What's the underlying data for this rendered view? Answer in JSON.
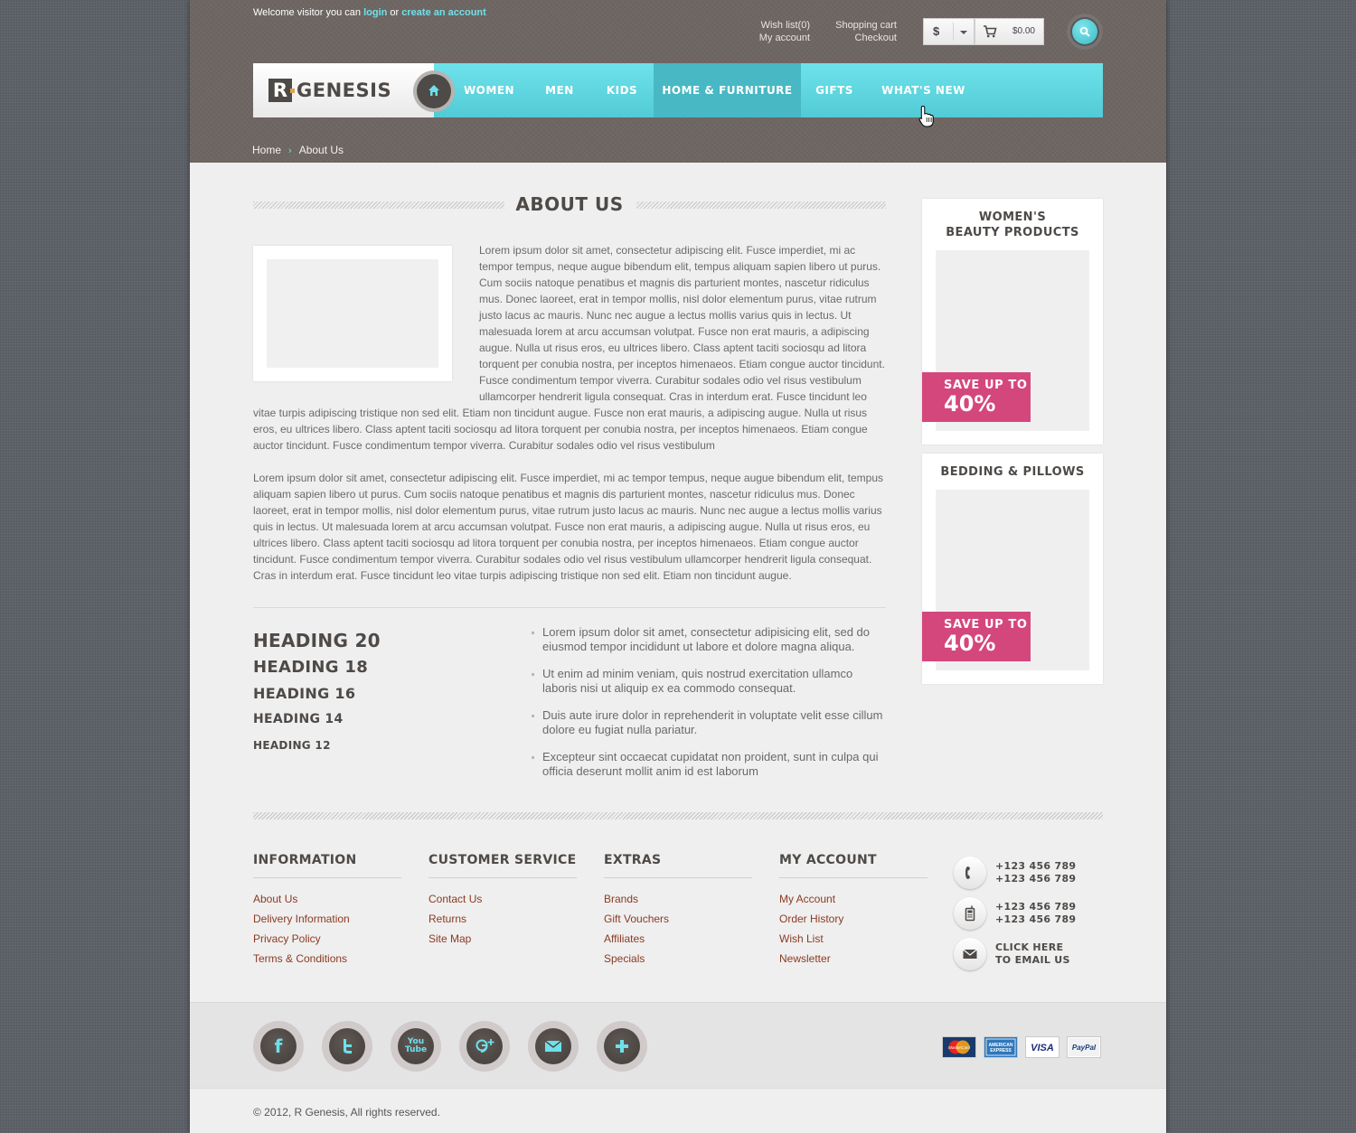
{
  "header": {
    "welcome_prefix": "Welcome visitor you can",
    "login_label": "login",
    "or_label": "or",
    "create_account_label": "create an account",
    "wishlist_label": "Wish list(0)",
    "my_account_label": "My account",
    "shopping_cart_label": "Shopping cart",
    "checkout_label": "Checkout",
    "currency": "$",
    "cart_total": "$0.00"
  },
  "logo": {
    "mark": "R",
    "text": "GENESIS"
  },
  "nav": {
    "items": [
      {
        "label": "WOMEN"
      },
      {
        "label": "MEN"
      },
      {
        "label": "KIDS"
      },
      {
        "label": "HOME & FURNITURE",
        "active": true
      },
      {
        "label": "GIFTS"
      },
      {
        "label": "WHAT'S NEW"
      }
    ]
  },
  "breadcrumb": {
    "home": "Home",
    "current": "About Us"
  },
  "main": {
    "title": "ABOUT US",
    "p1_part1": "Lorem ipsum dolor sit amet, consectetur adipiscing elit. Fusce imperdiet, mi ac tempor tempus, neque augue bibendum elit, tempus aliquam sapien libero ut purus. Cum sociis natoque penatibus et magnis dis parturient montes, nascetur ridiculus mus. Donec laoreet, erat in tempor mollis, nisl dolor elementum purus, vitae rutrum justo lacus ac mauris. Nunc nec augue a lectus mollis varius quis in lectus. Ut malesuada lorem at arcu accumsan volutpat. Fusce non erat mauris, a adipiscing augue. Nulla ut risus eros, eu ultrices libero. Class aptent taciti sociosqu ad litora torquent per conubia nostra, per inceptos himenaeos. Etiam congue auctor tincidunt. Fusce condimentum tempor viverra. Curabitur sodales odio vel risus vestibulum ullamcorper hendrerit ligula consequat. Cras in interdum erat. Fusce tincidunt leo",
    "p1_part2": "vitae turpis adipiscing tristique non sed elit. Etiam non tincidunt augue. Fusce non erat mauris, a adipiscing augue. Nulla ut risus eros, eu ultrices libero. Class aptent taciti sociosqu ad litora torquent per conubia nostra, per inceptos himenaeos. Etiam congue auctor tincidunt. Fusce condimentum tempor viverra. Curabitur sodales odio vel risus vestibulum",
    "p2": "Lorem ipsum dolor sit amet, consectetur adipiscing elit. Fusce imperdiet, mi ac tempor tempus, neque augue bibendum elit, tempus aliquam sapien libero ut purus. Cum sociis natoque penatibus et magnis dis parturient montes, nascetur ridiculus mus. Donec laoreet, erat in tempor mollis, nisl dolor elementum purus, vitae rutrum justo lacus ac mauris. Nunc nec augue a lectus mollis varius quis in lectus. Ut malesuada lorem at arcu accumsan volutpat. Fusce non erat mauris, a adipiscing augue. Nulla ut risus eros, eu ultrices libero. Class aptent taciti sociosqu ad litora torquent per conubia nostra, per inceptos himenaeos. Etiam congue auctor tincidunt. Fusce condimentum tempor viverra. Curabitur sodales odio vel risus vestibulum ullamcorper hendrerit ligula consequat. Cras in interdum erat. Fusce tincidunt leo vitae turpis adipiscing tristique non sed elit. Etiam non tincidunt augue.",
    "headings": [
      "HEADING 20",
      "HEADING 18",
      "HEADING 16",
      "HEADING 14",
      "HEADING 12"
    ],
    "bullets": [
      "Lorem ipsum dolor sit amet, consectetur adipisicing elit, sed do eiusmod tempor incididunt ut labore et dolore magna aliqua.",
      "Ut enim ad minim veniam, quis nostrud exercitation ullamco laboris nisi ut aliquip ex ea commodo consequat.",
      "Duis aute irure dolor in reprehenderit in voluptate velit esse cillum dolore eu fugiat nulla pariatur.",
      "Excepteur sint occaecat cupidatat non proident, sunt in culpa qui officia deserunt mollit anim id est laborum"
    ]
  },
  "sidebar": {
    "promo1": {
      "title_line1": "WOMEN'S",
      "title_line2": "BEAUTY PRODUCTS",
      "badge_line1": "SAVE UP TO",
      "badge_line2": "40%"
    },
    "promo2": {
      "title": "BEDDING & PILLOWS",
      "badge_line1": "SAVE UP TO",
      "badge_line2": "40%"
    }
  },
  "footer": {
    "columns": [
      {
        "heading": "INFORMATION",
        "links": [
          "About Us",
          "Delivery Information",
          "Privacy Policy",
          "Terms & Conditions"
        ]
      },
      {
        "heading": "CUSTOMER SERVICE",
        "links": [
          "Contact Us",
          "Returns",
          "Site Map"
        ]
      },
      {
        "heading": "EXTRAS",
        "links": [
          "Brands",
          "Gift Vouchers",
          "Affiliates",
          "Specials"
        ]
      },
      {
        "heading": "MY ACCOUNT",
        "links": [
          "My Account",
          "Order History",
          "Wish List",
          "Newsletter"
        ]
      }
    ],
    "contact": {
      "phone_line1": "+123 456 789",
      "phone_line2": "+123 456 789",
      "mobile_line1": "+123 456 789",
      "mobile_line2": "+123 456 789",
      "email_line1": "CLICK HERE",
      "email_line2": "TO EMAIL US"
    },
    "social_icons": [
      "facebook-icon",
      "twitter-icon",
      "youtube-icon",
      "google-plus-icon",
      "email-icon",
      "plus-icon"
    ],
    "youtube_text_top": "You",
    "youtube_text_bottom": "Tube",
    "payment": {
      "mastercard": "MasterCard",
      "amex_line1": "AMERICAN",
      "amex_line2": "EXPRESS",
      "visa": "VISA",
      "paypal": "PayPal"
    },
    "copyright": "© 2012, R Genesis, All rights reserved."
  },
  "colors": {
    "accent": "#55cfd9",
    "header_bg": "#6e6662",
    "promo_badge": "#d4477c",
    "link": "#8b3b22",
    "dark_text": "#4e4a47"
  }
}
